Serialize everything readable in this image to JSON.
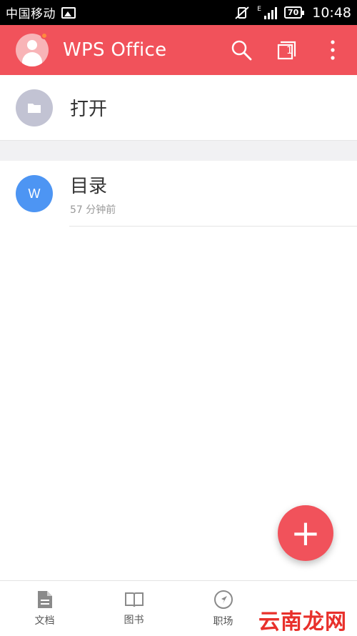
{
  "status_bar": {
    "carrier": "中国移动",
    "network": "E",
    "battery": "70",
    "time": "10:48"
  },
  "app_bar": {
    "title": "WPS Office",
    "tab_count": "1"
  },
  "open_row": {
    "label": "打开"
  },
  "recent": {
    "items": [
      {
        "name": "目录",
        "time": "57 分钟前",
        "icon_letter": "W"
      }
    ]
  },
  "fab": {
    "label": "+"
  },
  "bottom_nav": {
    "items": [
      {
        "label": "文档",
        "icon": "document-icon"
      },
      {
        "label": "图书",
        "icon": "book-icon"
      },
      {
        "label": "职场",
        "icon": "compass-icon"
      },
      {
        "label": "",
        "icon": ""
      }
    ]
  },
  "watermark": "云南龙网",
  "colors": {
    "accent": "#f1525b",
    "folder_circle": "#c2c3d3",
    "doc_circle": "#4d95f3"
  }
}
